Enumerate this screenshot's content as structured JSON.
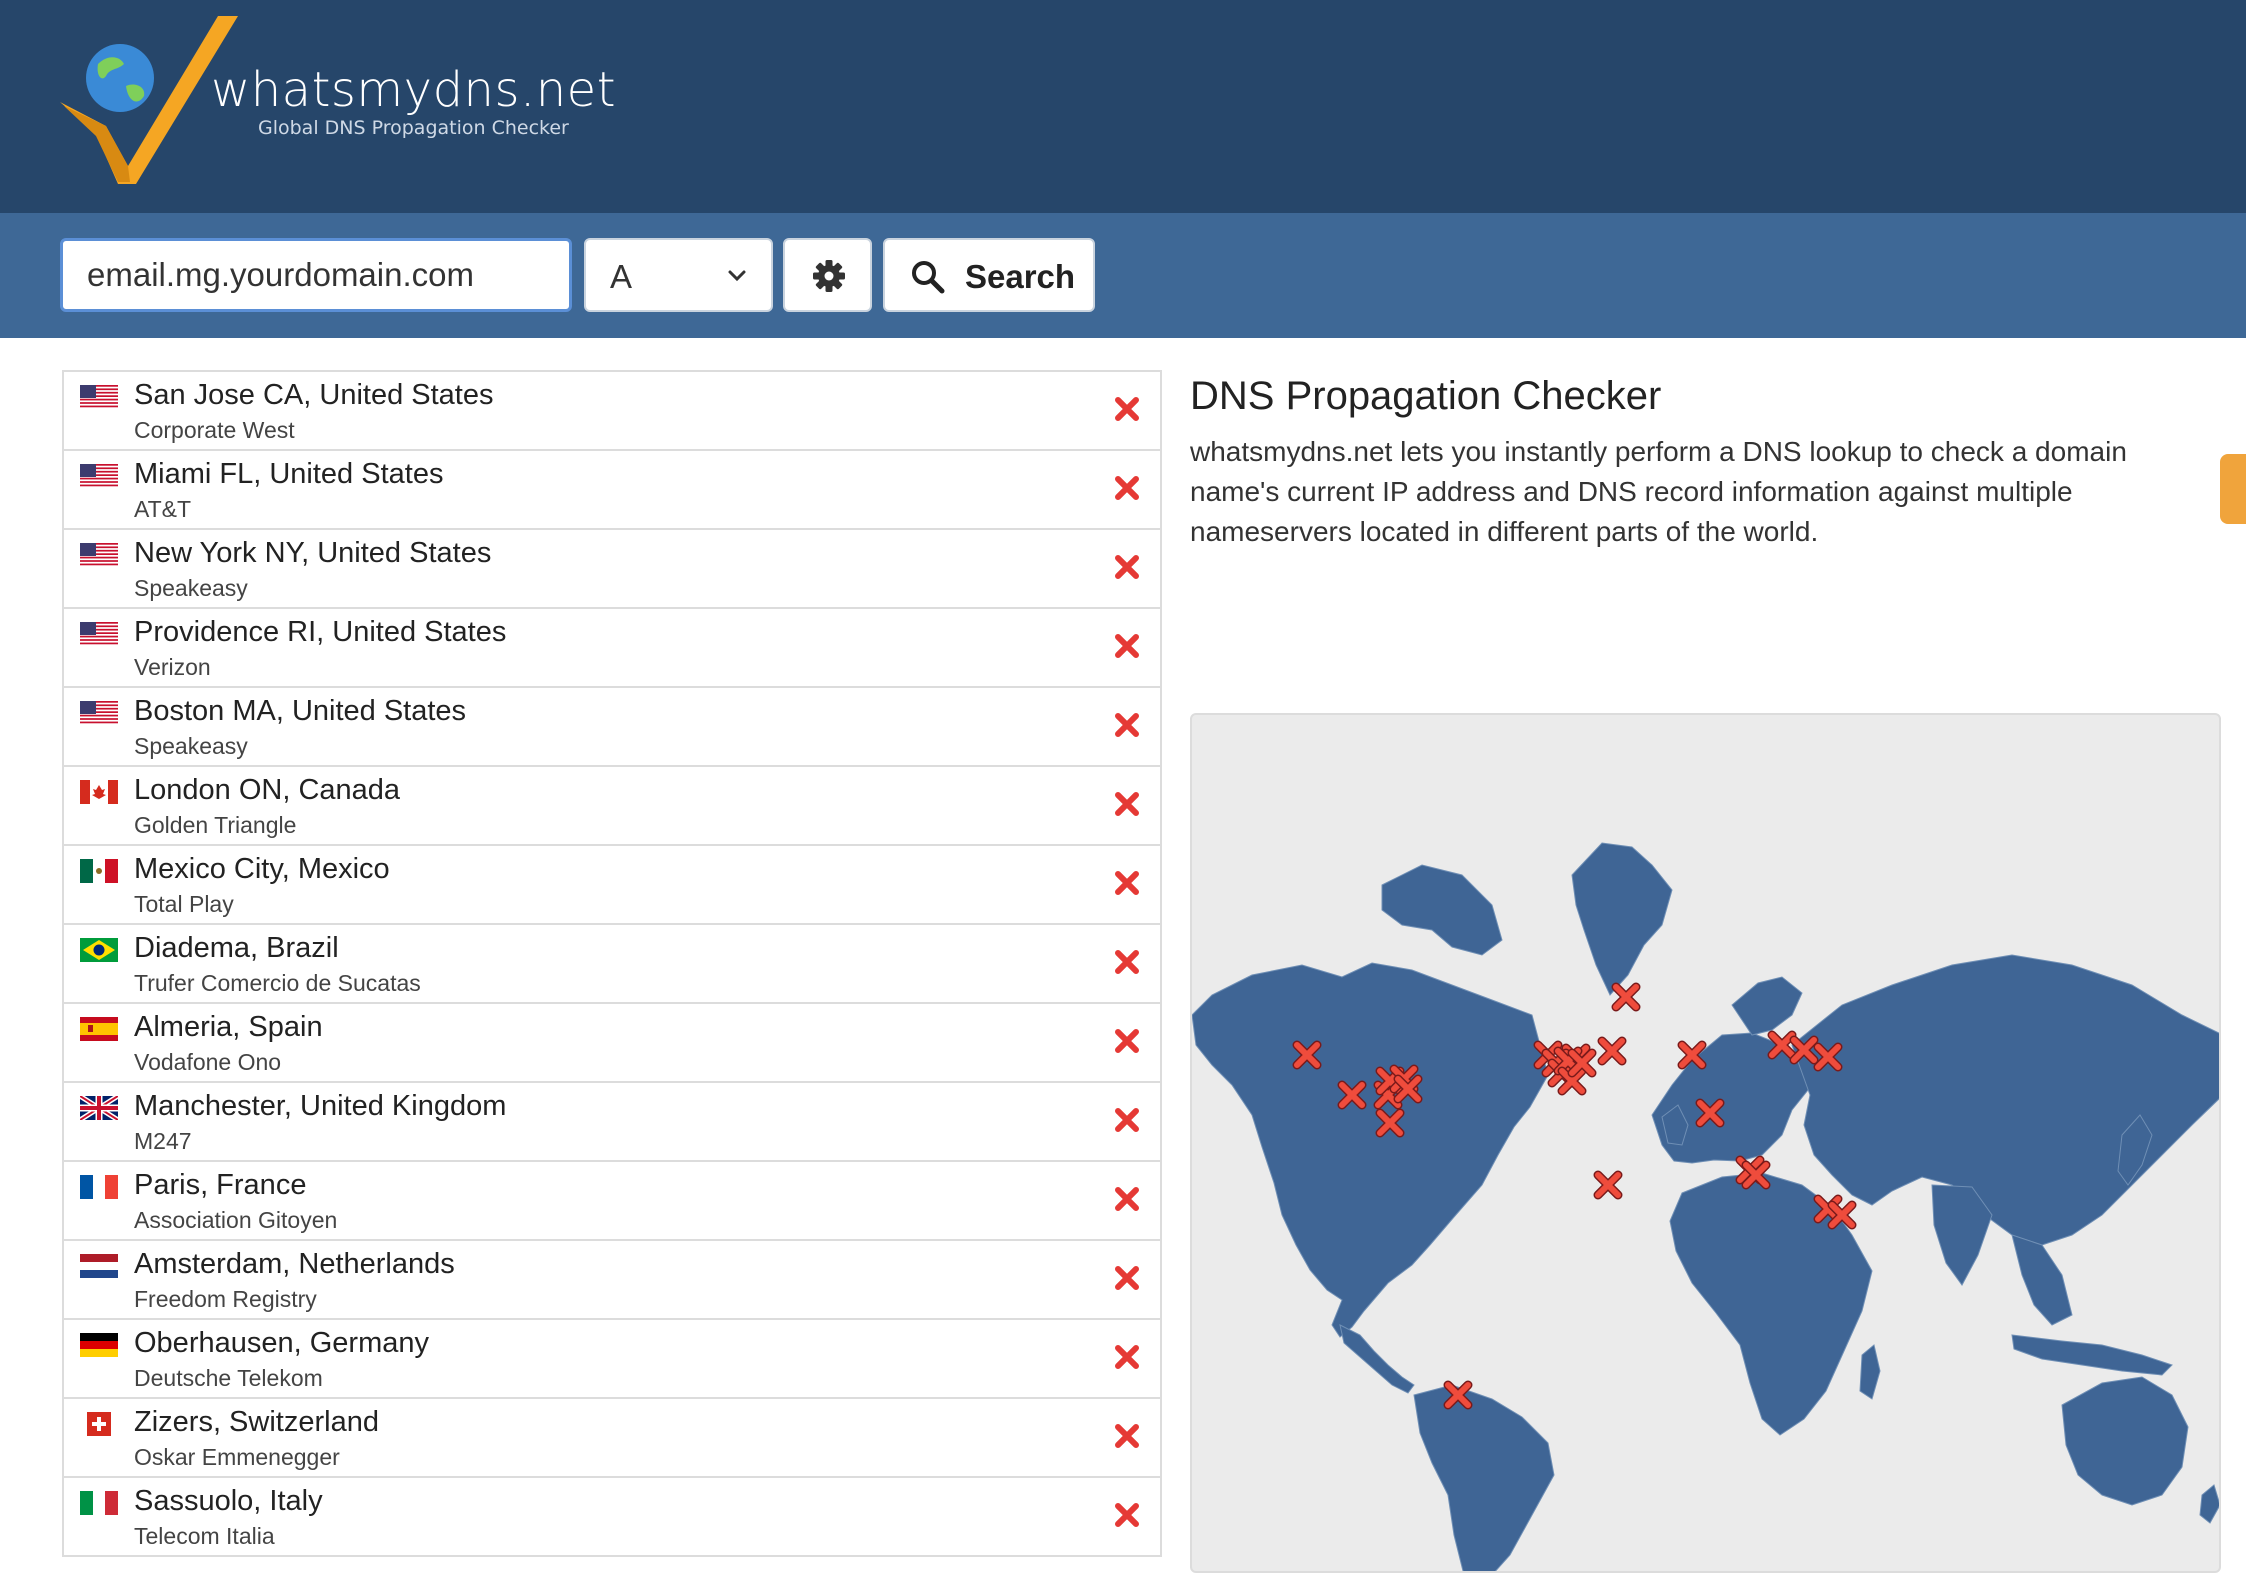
{
  "header": {
    "brand": "whatsmydns.net",
    "tagline": "Global DNS Propagation Checker"
  },
  "search": {
    "domain_value": "email.mg.yourdomain.com",
    "record_type": "A",
    "settings_icon": "gear-icon",
    "search_icon": "magnifier-icon",
    "search_label": "Search"
  },
  "results": [
    {
      "location": "San Jose CA, United States",
      "provider": "Corporate West",
      "flag": "us",
      "status": "fail"
    },
    {
      "location": "Miami FL, United States",
      "provider": "AT&T",
      "flag": "us",
      "status": "fail"
    },
    {
      "location": "New York NY, United States",
      "provider": "Speakeasy",
      "flag": "us",
      "status": "fail"
    },
    {
      "location": "Providence RI, United States",
      "provider": "Verizon",
      "flag": "us",
      "status": "fail"
    },
    {
      "location": "Boston MA, United States",
      "provider": "Speakeasy",
      "flag": "us",
      "status": "fail"
    },
    {
      "location": "London ON, Canada",
      "provider": "Golden Triangle",
      "flag": "ca",
      "status": "fail"
    },
    {
      "location": "Mexico City, Mexico",
      "provider": "Total Play",
      "flag": "mx",
      "status": "fail"
    },
    {
      "location": "Diadema, Brazil",
      "provider": "Trufer Comercio de Sucatas",
      "flag": "br",
      "status": "fail"
    },
    {
      "location": "Almeria, Spain",
      "provider": "Vodafone Ono",
      "flag": "es",
      "status": "fail"
    },
    {
      "location": "Manchester, United Kingdom",
      "provider": "M247",
      "flag": "gb",
      "status": "fail"
    },
    {
      "location": "Paris, France",
      "provider": "Association Gitoyen",
      "flag": "fr",
      "status": "fail"
    },
    {
      "location": "Amsterdam, Netherlands",
      "provider": "Freedom Registry",
      "flag": "nl",
      "status": "fail"
    },
    {
      "location": "Oberhausen, Germany",
      "provider": "Deutsche Telekom",
      "flag": "de",
      "status": "fail"
    },
    {
      "location": "Zizers, Switzerland",
      "provider": "Oskar Emmenegger",
      "flag": "ch",
      "status": "fail"
    },
    {
      "location": "Sassuolo, Italy",
      "provider": "Telecom Italia",
      "flag": "it",
      "status": "fail"
    }
  ],
  "info": {
    "title": "DNS Propagation Checker",
    "description": "whatsmydns.net lets you instantly perform a DNS lookup to check a domain name's current IP address and DNS record information against multiple nameservers located in different parts of the world."
  },
  "colors": {
    "header_bg": "#26466a",
    "searchbar_bg": "#3e6896",
    "map_land": "#3f6595",
    "marker_red": "#e53935"
  }
}
